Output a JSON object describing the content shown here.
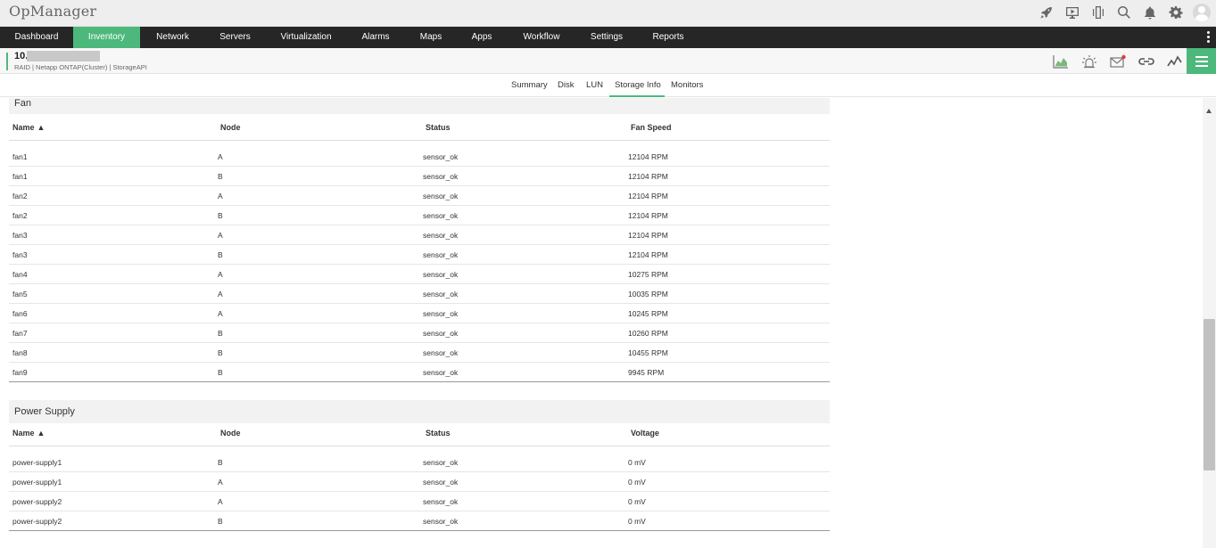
{
  "app": {
    "title": "OpManager"
  },
  "top_icons": [
    "rocket-icon",
    "monitor-play-icon",
    "phone-vibrate-icon",
    "search-icon",
    "bell-icon",
    "gear-icon",
    "user-avatar-icon"
  ],
  "nav": {
    "items": [
      {
        "label": "Dashboard",
        "active": false
      },
      {
        "label": "Inventory",
        "active": true
      },
      {
        "label": "Network",
        "active": false
      },
      {
        "label": "Servers",
        "active": false
      },
      {
        "label": "Virtualization",
        "active": false
      },
      {
        "label": "Alarms",
        "active": false
      },
      {
        "label": "Maps",
        "active": false
      },
      {
        "label": "Apps",
        "active": false
      },
      {
        "label": "Workflow",
        "active": false
      },
      {
        "label": "Settings",
        "active": false
      },
      {
        "label": "Reports",
        "active": false
      }
    ]
  },
  "device": {
    "ip_prefix": "10.",
    "subtitle": "RAID | Netapp ONTAP(Cluster)  | StorageAPI"
  },
  "subtabs": [
    {
      "label": "Summary",
      "active": false
    },
    {
      "label": "Disk",
      "active": false
    },
    {
      "label": "LUN",
      "active": false
    },
    {
      "label": "Storage Info",
      "active": true
    },
    {
      "label": "Monitors",
      "active": false
    }
  ],
  "fan": {
    "title": "Fan",
    "columns": [
      "Name",
      "Node",
      "Status",
      "Fan Speed"
    ],
    "rows": [
      [
        "fan1",
        "A",
        "sensor_ok",
        "12104 RPM"
      ],
      [
        "fan1",
        "B",
        "sensor_ok",
        "12104 RPM"
      ],
      [
        "fan2",
        "A",
        "sensor_ok",
        "12104 RPM"
      ],
      [
        "fan2",
        "B",
        "sensor_ok",
        "12104 RPM"
      ],
      [
        "fan3",
        "A",
        "sensor_ok",
        "12104 RPM"
      ],
      [
        "fan3",
        "B",
        "sensor_ok",
        "12104 RPM"
      ],
      [
        "fan4",
        "A",
        "sensor_ok",
        "10275 RPM"
      ],
      [
        "fan5",
        "A",
        "sensor_ok",
        "10035 RPM"
      ],
      [
        "fan6",
        "A",
        "sensor_ok",
        "10245 RPM"
      ],
      [
        "fan7",
        "B",
        "sensor_ok",
        "10260 RPM"
      ],
      [
        "fan8",
        "B",
        "sensor_ok",
        "10455 RPM"
      ],
      [
        "fan9",
        "B",
        "sensor_ok",
        "9945 RPM"
      ]
    ]
  },
  "power": {
    "title": "Power Supply",
    "columns": [
      "Name",
      "Node",
      "Status",
      "Voltage"
    ],
    "rows": [
      [
        "power-supply1",
        "B",
        "sensor_ok",
        "0 mV"
      ],
      [
        "power-supply1",
        "A",
        "sensor_ok",
        "0 mV"
      ],
      [
        "power-supply2",
        "A",
        "sensor_ok",
        "0 mV"
      ],
      [
        "power-supply2",
        "B",
        "sensor_ok",
        "0 mV"
      ]
    ]
  },
  "colors": {
    "accent": "#4db87c",
    "nav_bg": "#262626",
    "alert_dot": "#e53935"
  }
}
